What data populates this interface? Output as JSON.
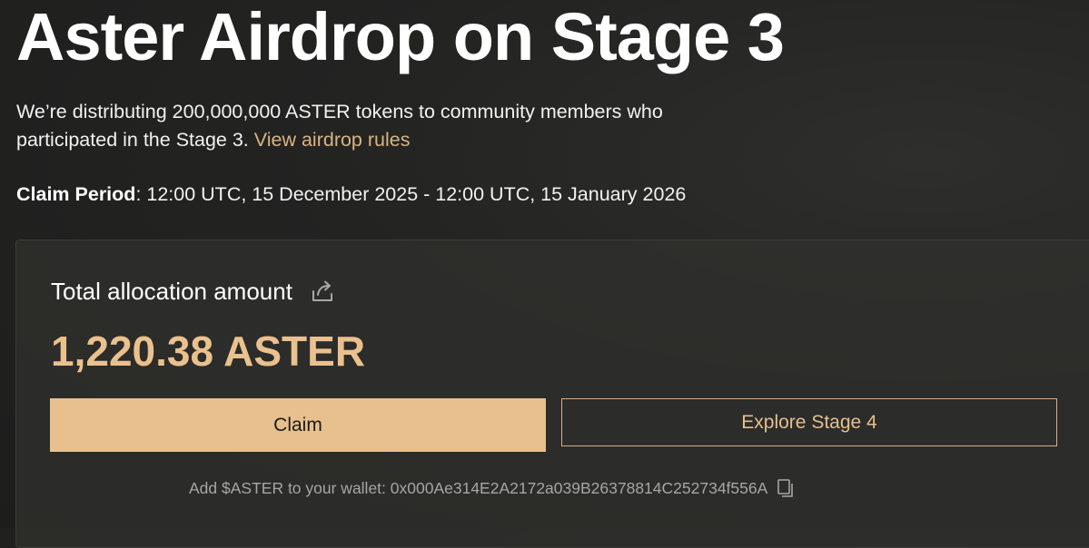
{
  "page": {
    "title": "Aster Airdrop on Stage 3",
    "description_text": "We’re distributing 200,000,000 ASTER tokens to community members who participated in the Stage 3.",
    "rules_link_label": "View airdrop rules",
    "claim_period_label": "Claim Period",
    "claim_period_value": ": 12:00 UTC, 15 December 2025 - 12:00 UTC, 15 January 2026"
  },
  "allocation": {
    "title": "Total allocation amount",
    "share_icon": "share-icon",
    "amount": "1,220.38 ASTER"
  },
  "actions": {
    "claim_label": "Claim",
    "explore_label": "Explore Stage 4"
  },
  "wallet": {
    "add_text": "Add $ASTER to your wallet: 0x000Ae314E2A2172a039B26378814C252734f556A",
    "copy_icon": "copy-icon"
  },
  "colors": {
    "background": "#232322",
    "accent": "#e8c08d",
    "link": "#d9b483",
    "amount": "#eac18e",
    "muted_text": "#a6a6a6"
  }
}
